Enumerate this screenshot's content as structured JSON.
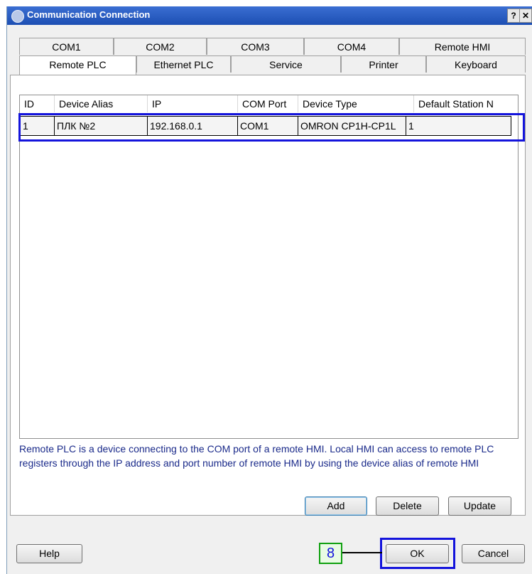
{
  "window": {
    "title": "Communication Connection",
    "help_btn": "?",
    "close_btn": "✕"
  },
  "tabs_row1": [
    "COM1",
    "COM2",
    "COM3",
    "COM4",
    "Remote HMI"
  ],
  "tabs_row2": [
    "Remote PLC",
    "Ethernet PLC",
    "Service",
    "Printer",
    "Keyboard"
  ],
  "table": {
    "headers": [
      "ID",
      "Device Alias",
      "IP",
      "COM Port",
      "Device Type",
      "Default Station N"
    ],
    "rows": [
      [
        "1",
        "ПЛК №2",
        "192.168.0.1",
        "COM1",
        "OMRON CP1H-CP1L",
        "1"
      ]
    ]
  },
  "description": "Remote PLC is a device connecting to the COM port of a remote HMI. Local HMI can access to remote PLC registers through the IP address and port number of remote HMI by using the device alias of remote HMI",
  "buttons": {
    "add": "Add",
    "delete": "Delete",
    "update": "Update",
    "help": "Help",
    "ok": "OK",
    "cancel": "Cancel"
  },
  "callout": "8",
  "colors": {
    "highlight": "#1414dc",
    "callout_border": "#10a010",
    "callout_fill": "#e9fbe4",
    "title_bar": "#1d4fb3"
  }
}
